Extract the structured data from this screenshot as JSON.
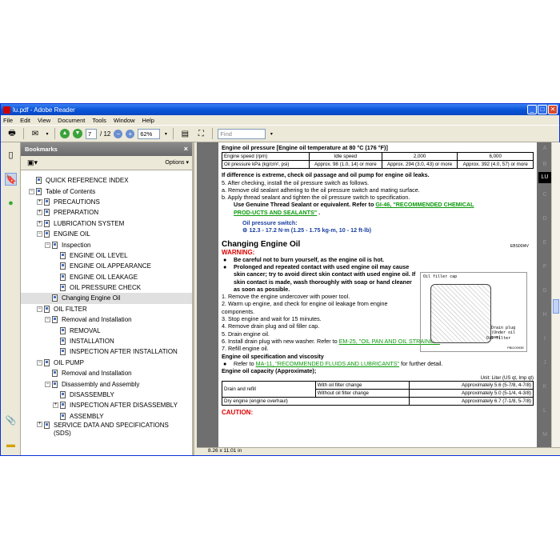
{
  "window": {
    "title": "lu.pdf - Adobe Reader",
    "min": "_",
    "max": "□",
    "close": "✕"
  },
  "menu": [
    "File",
    "Edit",
    "View",
    "Document",
    "Tools",
    "Window",
    "Help"
  ],
  "toolbar": {
    "page_current": "7",
    "page_total": "/ 12",
    "zoom": "62%",
    "find_placeholder": "Find"
  },
  "bookmarks": {
    "header": "Bookmarks",
    "close": "×",
    "options": "Options ▾",
    "items": [
      {
        "label": "QUICK REFERENCE INDEX",
        "level": 0,
        "exp": ""
      },
      {
        "label": "Table of Contents",
        "level": 0,
        "exp": "−"
      },
      {
        "label": "PRECAUTIONS",
        "level": 1,
        "exp": "+"
      },
      {
        "label": "PREPARATION",
        "level": 1,
        "exp": "+"
      },
      {
        "label": "LUBRICATION SYSTEM",
        "level": 1,
        "exp": "+"
      },
      {
        "label": "ENGINE OIL",
        "level": 1,
        "exp": "−"
      },
      {
        "label": "Inspection",
        "level": 2,
        "exp": "−"
      },
      {
        "label": "ENGINE OIL LEVEL",
        "level": 3,
        "exp": ""
      },
      {
        "label": "ENGINE OIL APPEARANCE",
        "level": 3,
        "exp": ""
      },
      {
        "label": "ENGINE OIL LEAKAGE",
        "level": 3,
        "exp": ""
      },
      {
        "label": "OIL PRESSURE CHECK",
        "level": 3,
        "exp": ""
      },
      {
        "label": "Changing Engine Oil",
        "level": 2,
        "exp": "",
        "selected": true
      },
      {
        "label": "OIL FILTER",
        "level": 1,
        "exp": "−"
      },
      {
        "label": "Removal and Installation",
        "level": 2,
        "exp": "−"
      },
      {
        "label": "REMOVAL",
        "level": 3,
        "exp": ""
      },
      {
        "label": "INSTALLATION",
        "level": 3,
        "exp": ""
      },
      {
        "label": "INSPECTION AFTER INSTALLATION",
        "level": 3,
        "exp": ""
      },
      {
        "label": "OIL PUMP",
        "level": 1,
        "exp": "−"
      },
      {
        "label": "Removal and Installation",
        "level": 2,
        "exp": ""
      },
      {
        "label": "Disassembly and Assembly",
        "level": 2,
        "exp": "−"
      },
      {
        "label": "DISASSEMBLY",
        "level": 3,
        "exp": ""
      },
      {
        "label": "INSPECTION AFTER DISASSEMBLY",
        "level": 3,
        "exp": "+"
      },
      {
        "label": "ASSEMBLY",
        "level": 3,
        "exp": ""
      },
      {
        "label": "SERVICE DATA AND SPECIFICATIONS (SDS)",
        "level": 1,
        "exp": "+",
        "wrap": true
      }
    ]
  },
  "doc": {
    "pressure_heading": "Engine oil pressure [Engine oil temperature at 80 °C (176 °F)]",
    "pressure_table": {
      "row1": [
        "Engine speed (rpm)",
        "Idle speed",
        "2,000",
        "6,000"
      ],
      "row2": [
        "Oil pressure kPa (kg/cm², psi)",
        "Approx. 98 (1.0, 14) or more",
        "Approx. 294 (3.0, 43) or more",
        "Approx. 392 (4.0, 57) or more"
      ]
    },
    "extreme": "If difference is extreme, check oil passage and oil pump for engine oil leaks.",
    "step5": "5.  After checking, install the oil pressure switch as follows.",
    "stepa": "a.  Remove old sealant adhering to the oil pressure switch and mating surface.",
    "stepb": "b.  Apply thread sealant and tighten the oil pressure switch to specification.",
    "sealant_pre": "Use Genuine Thread Sealant or equivalent. Refer to ",
    "sealant_link": "GI-46, \"RECOMMENDED CHEMICAL PROD-UCTS AND SEALANTS\"",
    "switch_label": "Oil pressure switch:",
    "torque": "12.3 - 17.2 N·m (1.25 - 1.75 kg-m, 10 - 12 ft-lb)",
    "section_title": "Changing Engine Oil",
    "section_code": "EBS00I4V",
    "warning_label": "WARNING:",
    "warn1": "Be careful not to burn yourself, as the engine oil is hot.",
    "warn2": "Prolonged and repeated contact with used engine oil may cause skin cancer; try to avoid direct skin contact with used engine oil. If skin contact is made, wash thoroughly with soap or hand cleaner as soon as possible.",
    "s1": "1.  Remove the engine undercover with power tool.",
    "s2": "2.  Warm up engine, and check for engine oil leakage from engine components.",
    "s3": "3.  Stop engine and wait for 15 minutes.",
    "s4": "4.  Remove drain plug and oil filler cap.",
    "s5": "5.  Drain engine oil.",
    "s6_pre": "6.  Install drain plug with new washer. Refer to ",
    "s6_link": "EM-25, \"OIL PAN AND OIL STRAINER\"",
    "s7": "7.  Refill engine oil.",
    "spec_head": "Engine oil specification and viscosity",
    "spec_pre": "Refer to ",
    "spec_link": "MA-11, \"RECOMMENDED FLUIDS AND LUBRICANTS\"",
    "spec_post": " for further detail.",
    "cap_head": "Engine oil capacity (Approximate);",
    "unit": "Unit: Liter (US qt, Imp qt)",
    "cap_table": {
      "drain_refill": "Drain and refill",
      "with_filter": "With oil filter change",
      "with_val": "Approximately 5.6 (5-7/8, 4-7/8)",
      "without_filter": "Without oil filter change",
      "without_val": "Approximately 5.0 (5-1/4, 4-3/8)",
      "dry": "Dry engine (engine overhaul)",
      "dry_val": "Approximately 6.7 (7-1/8, 5-7/8)"
    },
    "caution": "CAUTION:",
    "fig_labels": {
      "cap": "Oil filler cap",
      "drain": "Drain plug",
      "drain_sub": "(Under oil pan)",
      "filter": "Oil filter",
      "code": "PBIC0093E"
    }
  },
  "right_tabs": [
    "A",
    "B",
    "LU",
    "C",
    "D",
    "E",
    "F",
    "G",
    "H",
    "I",
    "J",
    "K",
    "L",
    "M"
  ],
  "status": {
    "size": "8.26 x 11.01 in"
  }
}
